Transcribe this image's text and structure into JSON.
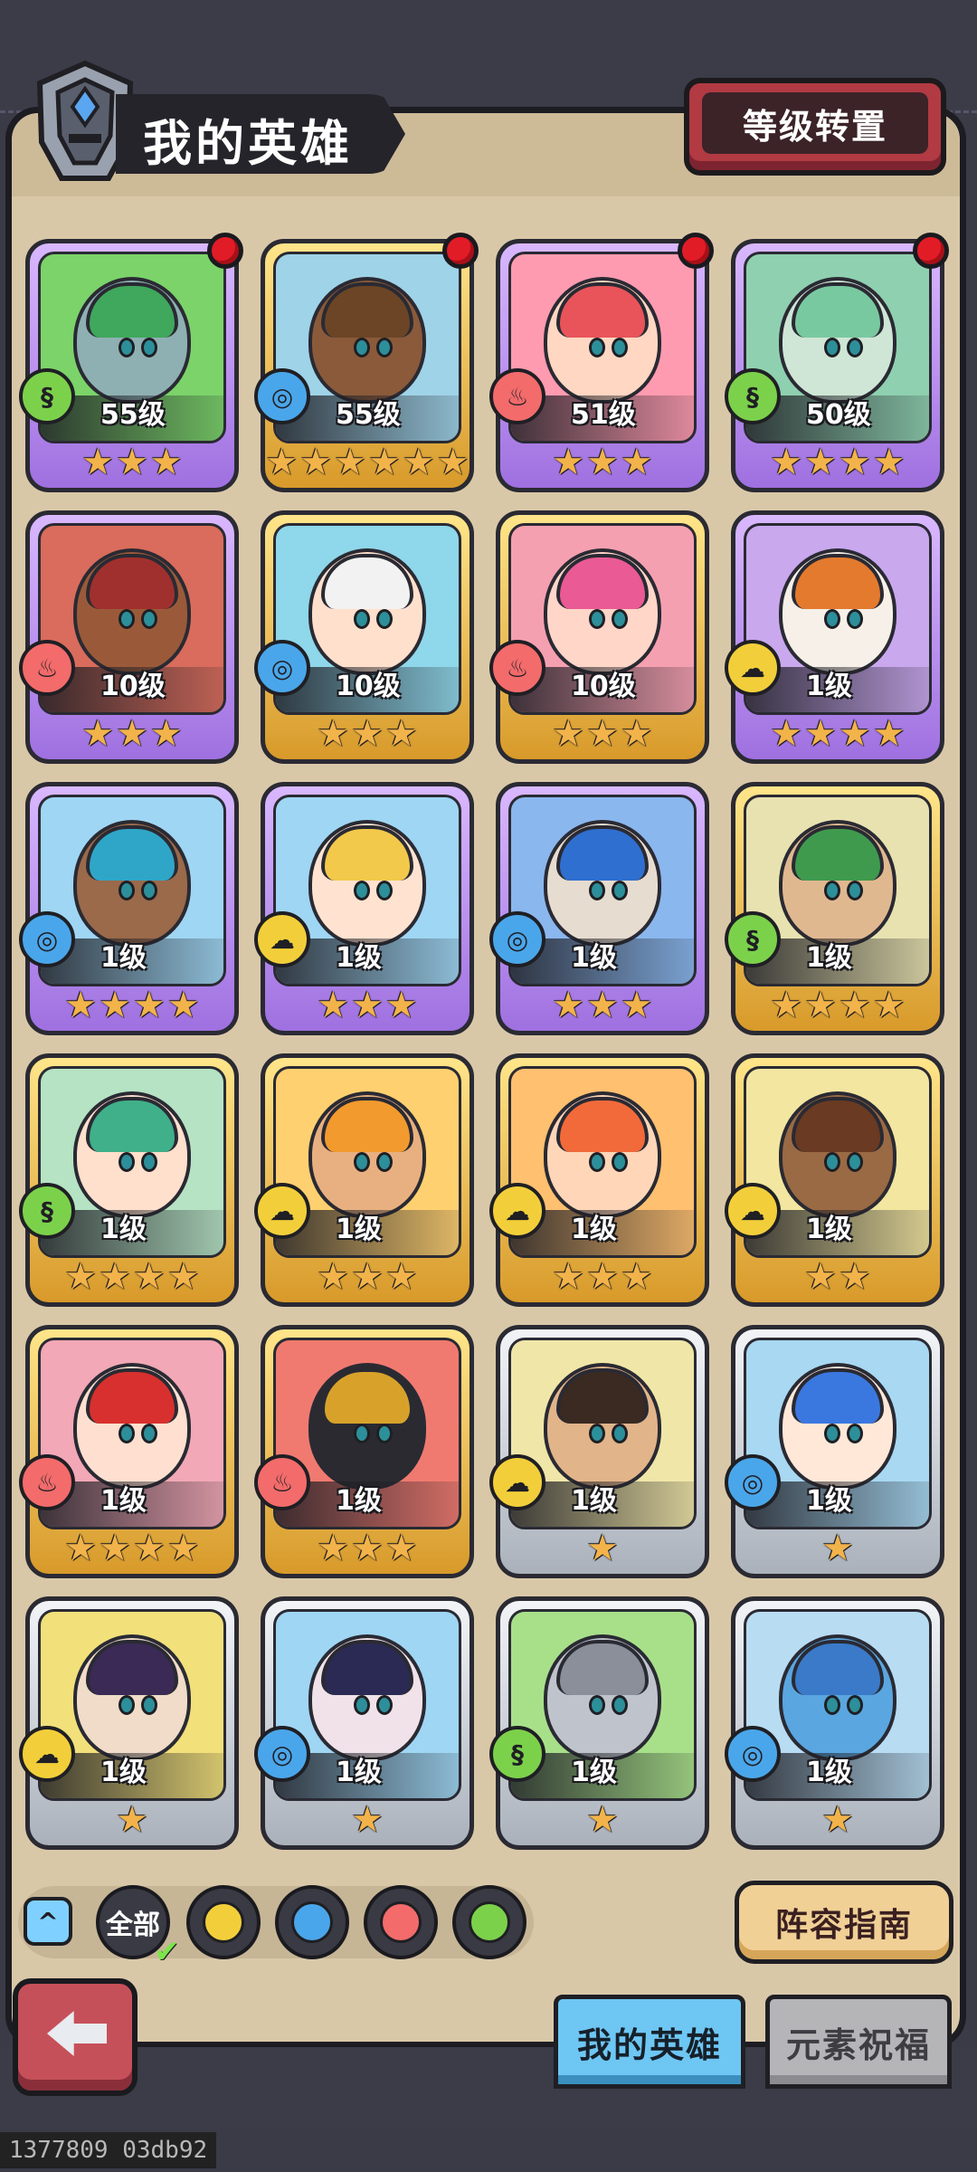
{
  "header": {
    "title": "我的英雄",
    "level_transfer_button": "等级转置"
  },
  "heroes": [
    {
      "level": "55级",
      "element": "grass",
      "stars": 3,
      "rarity": "purple",
      "notify": true,
      "skin": "#8fb0b3",
      "hair": "#3fa85c",
      "bg": "#7bd36a"
    },
    {
      "level": "55级",
      "element": "water",
      "stars": 6,
      "rarity": "gold",
      "notify": true,
      "skin": "#8a5a3a",
      "hair": "#6b4526",
      "bg": "#9fd3e8"
    },
    {
      "level": "51级",
      "element": "fire",
      "stars": 3,
      "rarity": "purple",
      "notify": true,
      "skin": "#ffd7c2",
      "hair": "#e8545a",
      "bg": "#ff9bb0"
    },
    {
      "level": "50级",
      "element": "grass",
      "stars": 4,
      "rarity": "purple",
      "notify": true,
      "skin": "#cfe6d6",
      "hair": "#79c9a0",
      "bg": "#8fd0b0"
    },
    {
      "level": "10级",
      "element": "fire",
      "stars": 3,
      "rarity": "purple",
      "notify": false,
      "skin": "#9a5a3a",
      "hair": "#a0302e",
      "bg": "#d96c5c"
    },
    {
      "level": "10级",
      "element": "water",
      "stars": 3,
      "rarity": "gold",
      "notify": false,
      "skin": "#ffe0cc",
      "hair": "#f2f2f2",
      "bg": "#8fd7ea"
    },
    {
      "level": "10级",
      "element": "fire",
      "stars": 3,
      "rarity": "gold",
      "notify": false,
      "skin": "#ffd6c8",
      "hair": "#ea5a95",
      "bg": "#f5a0b0"
    },
    {
      "level": "1级",
      "element": "earth",
      "stars": 4,
      "rarity": "purple",
      "notify": false,
      "skin": "#f6f0e8",
      "hair": "#e47a2e",
      "bg": "#c9a8ee"
    },
    {
      "level": "1级",
      "element": "water",
      "stars": 4,
      "rarity": "purple",
      "notify": false,
      "skin": "#9a6a4a",
      "hair": "#2fa6c8",
      "bg": "#9fd6f3"
    },
    {
      "level": "1级",
      "element": "earth",
      "stars": 3,
      "rarity": "purple",
      "notify": false,
      "skin": "#ffe3d0",
      "hair": "#f2c94a",
      "bg": "#9fd6f3"
    },
    {
      "level": "1级",
      "element": "water",
      "stars": 3,
      "rarity": "purple",
      "notify": false,
      "skin": "#e7dcd0",
      "hair": "#2f6fd0",
      "bg": "#8ab7ee"
    },
    {
      "level": "1级",
      "element": "grass",
      "stars": 4,
      "rarity": "gold",
      "notify": false,
      "skin": "#e0b890",
      "hair": "#3f9a4e",
      "bg": "#e8e2b0"
    },
    {
      "level": "1级",
      "element": "grass",
      "stars": 4,
      "rarity": "gold",
      "notify": false,
      "skin": "#ffe0cc",
      "hair": "#3fb08a",
      "bg": "#b6e3c4"
    },
    {
      "level": "1级",
      "element": "earth",
      "stars": 3,
      "rarity": "gold",
      "notify": false,
      "skin": "#e8b080",
      "hair": "#f29a2e",
      "bg": "#ffd070"
    },
    {
      "level": "1级",
      "element": "earth",
      "stars": 3,
      "rarity": "gold",
      "notify": false,
      "skin": "#ffd6b8",
      "hair": "#f26a3a",
      "bg": "#ffc070"
    },
    {
      "level": "1级",
      "element": "earth",
      "stars": 2,
      "rarity": "gold",
      "notify": false,
      "skin": "#9a6a44",
      "hair": "#6a3a22",
      "bg": "#f2e6a0"
    },
    {
      "level": "1级",
      "element": "fire",
      "stars": 4,
      "rarity": "gold",
      "notify": false,
      "skin": "#ffe0d0",
      "hair": "#d8302e",
      "bg": "#f2a8b6"
    },
    {
      "level": "1级",
      "element": "fire",
      "stars": 3,
      "rarity": "gold",
      "notify": false,
      "skin": "#2a2a30",
      "hair": "#d8a22a",
      "bg": "#f07a70"
    },
    {
      "level": "1级",
      "element": "earth",
      "stars": 1,
      "rarity": "silver",
      "notify": false,
      "skin": "#e2b48a",
      "hair": "#3a2a22",
      "bg": "#f0e6a8"
    },
    {
      "level": "1级",
      "element": "water",
      "stars": 1,
      "rarity": "silver",
      "notify": false,
      "skin": "#ffe8d8",
      "hair": "#3a78e0",
      "bg": "#a8d8f2"
    },
    {
      "level": "1级",
      "element": "earth",
      "stars": 1,
      "rarity": "silver",
      "notify": false,
      "skin": "#f0dcc8",
      "hair": "#3a2a55",
      "bg": "#f2e07a"
    },
    {
      "level": "1级",
      "element": "water",
      "stars": 1,
      "rarity": "silver",
      "notify": false,
      "skin": "#f0e2e8",
      "hair": "#2a2a55",
      "bg": "#9fd6f3"
    },
    {
      "level": "1级",
      "element": "grass",
      "stars": 1,
      "rarity": "silver",
      "notify": false,
      "skin": "#bfc4cc",
      "hair": "#8a8f99",
      "bg": "#a8e08a"
    },
    {
      "level": "1级",
      "element": "water",
      "stars": 1,
      "rarity": "silver",
      "notify": false,
      "skin": "#5aa6e0",
      "hair": "#3a7ac8",
      "bg": "#b8dcf2"
    }
  ],
  "filters": {
    "all_label": "全部",
    "elements": [
      "earth",
      "water",
      "fire",
      "grass"
    ]
  },
  "element_colors": {
    "grass": "#7cd14b",
    "water": "#4aa6ea",
    "fire": "#f36b6b",
    "earth": "#f2cf3a"
  },
  "guide_button": "阵容指南",
  "tabs": {
    "my_heroes": "我的英雄",
    "element_blessing": "元素祝福"
  },
  "footer_id": "1377809 03db92"
}
